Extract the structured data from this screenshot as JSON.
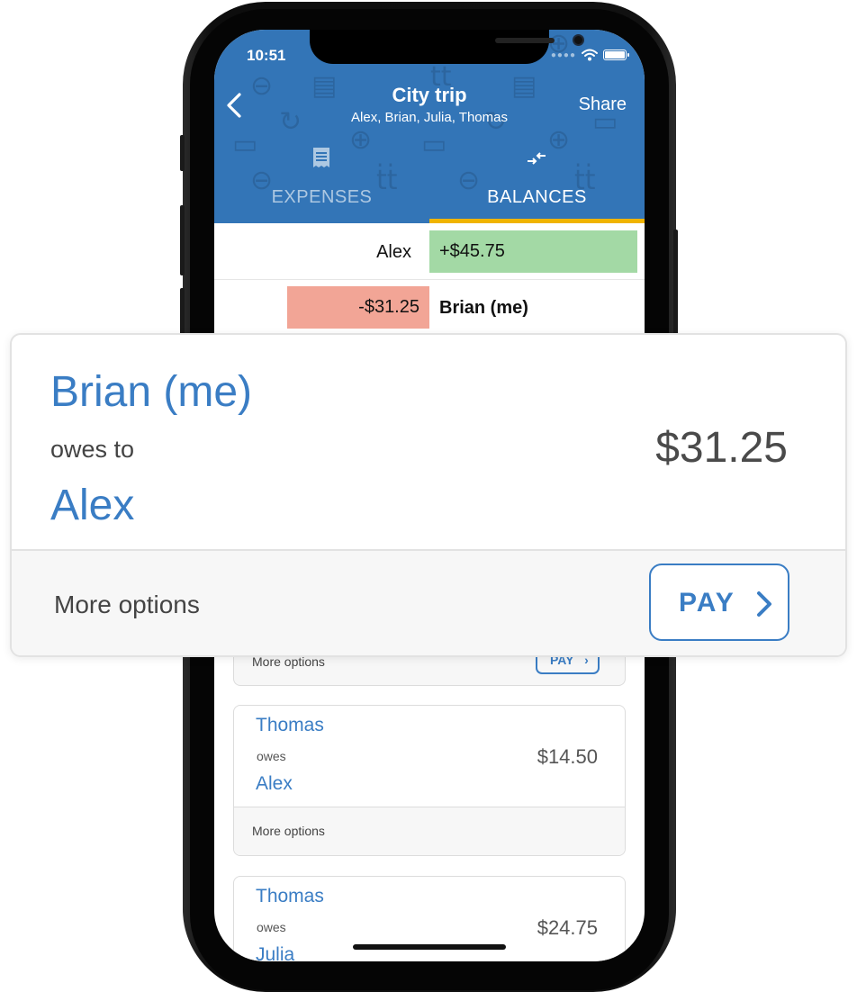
{
  "status_bar": {
    "time": "10:51"
  },
  "header": {
    "title": "City trip",
    "subtitle": "Alex, Brian, Julia, Thomas",
    "share_label": "Share",
    "background_color": "#3375b7"
  },
  "tabs": [
    {
      "label": "EXPENSES",
      "icon": "receipt-icon",
      "active": false
    },
    {
      "label": "BALANCES",
      "icon": "transfer-arrows-icon",
      "active": true
    }
  ],
  "balances": [
    {
      "name": "Alex",
      "amount": "+$45.75",
      "positive": true
    },
    {
      "name": "Brian (me)",
      "amount": "-$31.25",
      "positive": false
    }
  ],
  "settlement_partial": {
    "more_options": "More options",
    "pay_label": "PAY"
  },
  "settlements": [
    {
      "from": "Thomas",
      "verb": "owes",
      "to": "Alex",
      "amount": "$14.50",
      "more_options": "More options"
    },
    {
      "from": "Thomas",
      "verb": "owes",
      "to": "Julia",
      "amount": "$24.75"
    }
  ],
  "highlight": {
    "from": "Brian (me)",
    "verb": "owes to",
    "to": "Alex",
    "amount": "$31.25",
    "more_options": "More options",
    "pay_label": "PAY"
  },
  "colors": {
    "accent": "#3a7dc4",
    "positive": "#a3d9a5",
    "negative": "#f2a596",
    "tab_indicator": "#f0b400"
  }
}
